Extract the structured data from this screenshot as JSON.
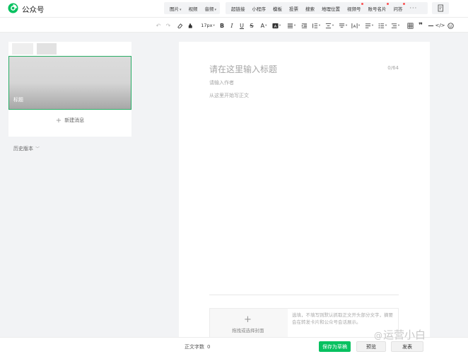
{
  "brand": {
    "name": "公众号",
    "accent": "#07c160"
  },
  "top_menu": {
    "group1": [
      {
        "label": "图片",
        "caret": true
      },
      {
        "label": "视频"
      },
      {
        "label": "音频",
        "caret": true
      }
    ],
    "group2": [
      {
        "label": "超链接"
      },
      {
        "label": "小程序"
      },
      {
        "label": "模板"
      },
      {
        "label": "投票"
      },
      {
        "label": "搜索"
      },
      {
        "label": "地理位置"
      },
      {
        "label": "视频号",
        "dot": true
      },
      {
        "label": "账号名片",
        "dot": true
      },
      {
        "label": "问答",
        "dot": true
      },
      {
        "label": "···"
      }
    ]
  },
  "format_toolbar": {
    "icons": [
      "undo-icon",
      "redo-icon",
      "clear-format-icon",
      "format-painter-icon",
      "font-size-select",
      "bold-icon",
      "italic-icon",
      "underline-icon",
      "strikethrough-icon",
      "font-color-icon",
      "background-color-icon",
      "align-icon",
      "indent-icon",
      "line-spacing-icon",
      "paragraph-spacing-icon",
      "letter-spacing-icon",
      "column-icon",
      "list-icon",
      "ordered-list-icon",
      "table-icon",
      "quote-icon",
      "divider-icon",
      "code-icon",
      "emoji-icon"
    ],
    "font_size": "17px",
    "bold": "B",
    "italic": "I",
    "underline": "U",
    "strike": "S",
    "font_color": "A"
  },
  "left_panel": {
    "cover_title": "标题",
    "new_message": "新建消息",
    "history": "历史版本"
  },
  "editor": {
    "title_placeholder": "请在这里输入标题",
    "title_counter": "0/64",
    "author_placeholder": "请输入作者",
    "body_placeholder": "从这里开始写正文",
    "cover_drop_label": "拖拽或选择封面",
    "digest_placeholder": "选填，不填写则默认抓取正文开头部分文字，摘要会在转发卡片和公众号会话展示。"
  },
  "bottom_bar": {
    "word_count_label": "正文字数",
    "word_count": "0",
    "save_draft": "保存为草稿",
    "preview": "预览",
    "publish": "发表"
  },
  "watermark": {
    "at": "@",
    "text": "运营小白"
  }
}
